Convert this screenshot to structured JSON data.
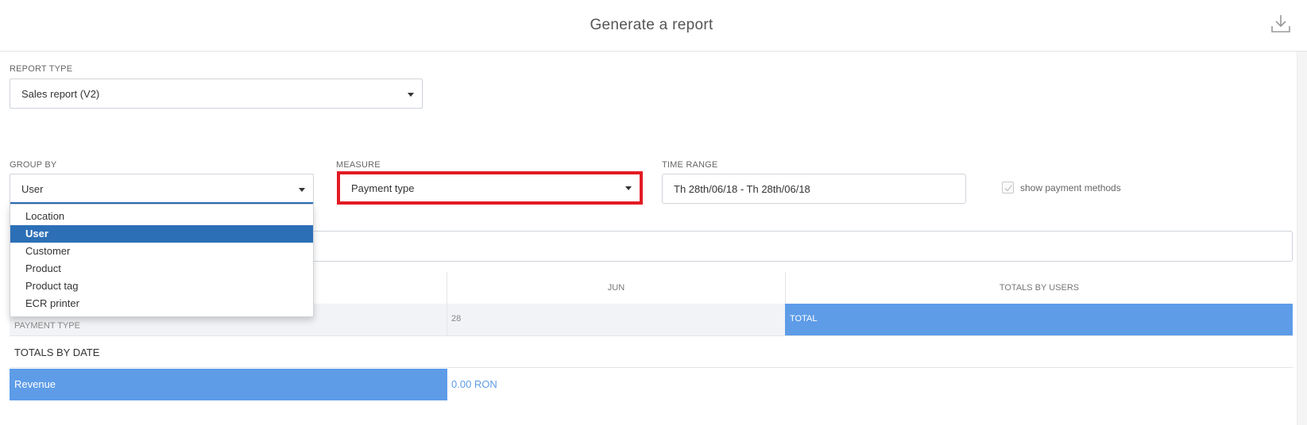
{
  "header": {
    "title": "Generate a report",
    "download_icon": "download-icon"
  },
  "report_type": {
    "label": "REPORT TYPE",
    "value": "Sales report (V2)"
  },
  "group_by": {
    "label": "GROUP BY",
    "value": "User",
    "options": [
      {
        "label": "Location"
      },
      {
        "label": "User"
      },
      {
        "label": "Customer"
      },
      {
        "label": "Product"
      },
      {
        "label": "Product tag"
      },
      {
        "label": "ECR printer"
      }
    ],
    "selected_option": "User"
  },
  "measure": {
    "label": "MEASURE",
    "value": "Payment type",
    "highlight_color": "#e21b24"
  },
  "time_range": {
    "label": "TIME RANGE",
    "value": "Th 28th/06/18 - Th 28th/06/18"
  },
  "show_payment_methods": {
    "label": "show payment methods",
    "checked": true
  },
  "table": {
    "month_header": "JUN",
    "totals_header": "TOTALS BY USERS",
    "row_label": "PAYMENT TYPE",
    "day": "28",
    "total_label": "TOTAL",
    "totals_by_date_label": "TOTALS BY DATE",
    "revenue_label": "Revenue",
    "revenue_value": "0.00 RON"
  },
  "colors": {
    "accent_blue": "#5e9ce8",
    "selected_blue": "#2c6fb7",
    "highlight_red": "#e21b24"
  }
}
